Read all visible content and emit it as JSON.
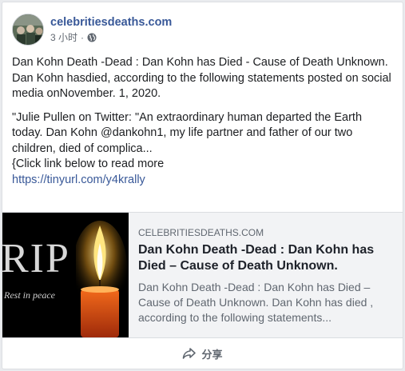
{
  "post": {
    "page_name": "celebritiesdeaths.com",
    "time": "3 小时",
    "separator": "·",
    "paragraphs": [
      "Dan Kohn Death -Dead : Dan Kohn has Died - Cause of Death Unknown.",
      "Dan Kohn hasdied, according to the following statements posted on social media onNovember. 1, 2020."
    ],
    "quote": "\"Julie Pullen on Twitter: \"An extraordinary human departed the Earth today. Dan Kohn @dankohn1, my life partner and father of our two children, died of complica...",
    "read_more": "{Click link below to read more",
    "link": "https://tinyurl.com/y4krally"
  },
  "preview": {
    "image_text_main": "RIP",
    "image_text_sub": "Rest in peace",
    "domain": "CELEBRITIESDEATHS.COM",
    "title": "Dan Kohn Death -Dead : Dan Kohn has Died – Cause of Death Unknown.",
    "description": "Dan Kohn Death -Dead : Dan Kohn has Died – Cause of Death Unknown. Dan Kohn has died , according to the following statements..."
  },
  "footer": {
    "share_label": "分享"
  },
  "icons": {
    "globe": "globe-icon",
    "share": "share-icon"
  },
  "colors": {
    "link": "#385898",
    "secondary_text": "#606770",
    "preview_bg": "#f2f3f5"
  }
}
